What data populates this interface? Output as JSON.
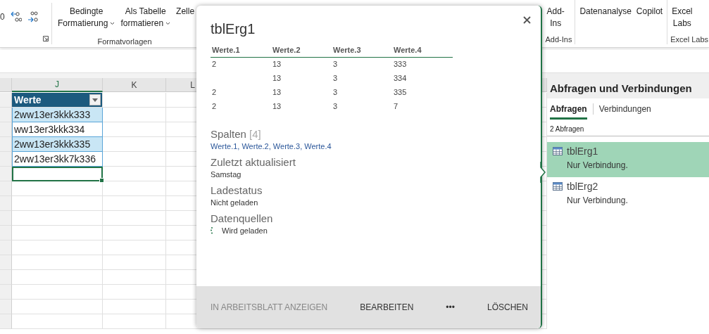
{
  "ribbon": {
    "partial_text": "0",
    "left_buttons": [
      {
        "lines": [
          "Bedingte",
          "Formatierung"
        ],
        "dropdown": true
      },
      {
        "lines": [
          "Als Tabelle",
          "formatieren"
        ],
        "dropdown": true
      },
      {
        "lines": [
          "Zelle"
        ]
      }
    ],
    "left_group": "Formatvorlagen",
    "right_groups": [
      {
        "label": "Add-Ins",
        "buttons": [
          {
            "lines": [
              "Add-",
              "Ins"
            ]
          }
        ]
      },
      {
        "buttons": [
          {
            "lines": [
              "Datenanalyse"
            ]
          },
          {
            "lines": [
              "Copilot"
            ]
          }
        ]
      },
      {
        "label": "Excel Labs",
        "buttons": [
          {
            "lines": [
              "Excel",
              "Labs"
            ]
          }
        ]
      }
    ]
  },
  "sheet": {
    "columns": [
      "J",
      "K",
      "L"
    ],
    "table_header": "Werte",
    "rows": [
      {
        "text": "2ww13er3kkk333",
        "shaded": true
      },
      {
        "text": "ww13er3kkk334",
        "shaded": false
      },
      {
        "text": "2ww13er3kkk335",
        "shaded": true
      },
      {
        "text": "2ww13er3kk7k336",
        "shaded": false
      }
    ],
    "active_cell_below": true
  },
  "popup": {
    "title": "tblErg1",
    "preview": {
      "columns": [
        "Werte.1",
        "Werte.2",
        "Werte.3",
        "Werte.4"
      ],
      "rows": [
        [
          "2",
          "13",
          "3",
          "333"
        ],
        [
          null,
          "13",
          "3",
          "334"
        ],
        [
          "2",
          "13",
          "3",
          "335"
        ],
        [
          "2",
          "13",
          "3",
          "7"
        ]
      ]
    },
    "sections": [
      {
        "heading": "Spalten",
        "count": "[4]",
        "value": "Werte.1, Werte.2, Werte.3, Werte.4",
        "kind": "link"
      },
      {
        "heading": "Zuletzt aktualisiert",
        "value": "Samstag",
        "kind": "text"
      },
      {
        "heading": "Ladestatus",
        "value": "Nicht geladen",
        "kind": "text"
      },
      {
        "heading": "Datenquellen",
        "value": "Wird geladen",
        "kind": "loading"
      }
    ],
    "actions": [
      {
        "label": "IN ARBEITSBLATT ANZEIGEN",
        "disabled": true
      },
      {
        "label": "BEARBEITEN",
        "disabled": false
      },
      {
        "label": "•••",
        "disabled": false
      },
      {
        "label": "LÖSCHEN",
        "disabled": false
      }
    ]
  },
  "pane": {
    "title": "Abfragen und Verbindungen",
    "tabs": [
      {
        "label": "Abfragen",
        "selected": true
      },
      {
        "label": "Verbindungen",
        "selected": false
      }
    ],
    "count": "2 Abfragen",
    "queries": [
      {
        "name": "tblErg1",
        "detail": "Nur Verbindung.",
        "selected": true
      },
      {
        "name": "tblErg2",
        "detail": "Nur Verbindung.",
        "selected": false
      }
    ]
  }
}
